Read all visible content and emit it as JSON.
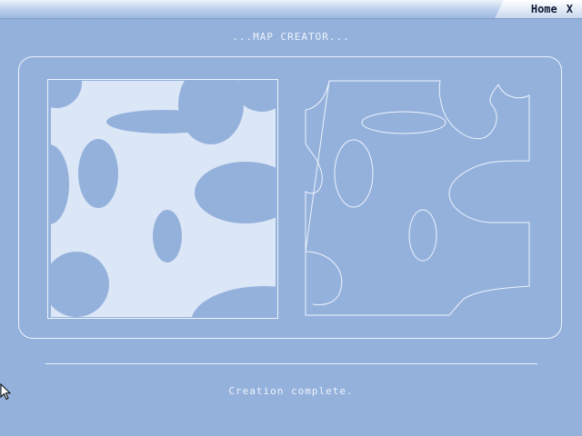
{
  "window": {
    "home_label": "Home",
    "close_label": "X"
  },
  "header": {
    "title": "...MAP CREATOR..."
  },
  "footer": {
    "status": "Creation complete."
  },
  "colors": {
    "background": "#94b1dc",
    "map_land": "#dbe6f7",
    "map_holes": "#94b1dc",
    "line": "#eef3fb"
  },
  "icons": {
    "cursor": "arrow-cursor-icon"
  }
}
